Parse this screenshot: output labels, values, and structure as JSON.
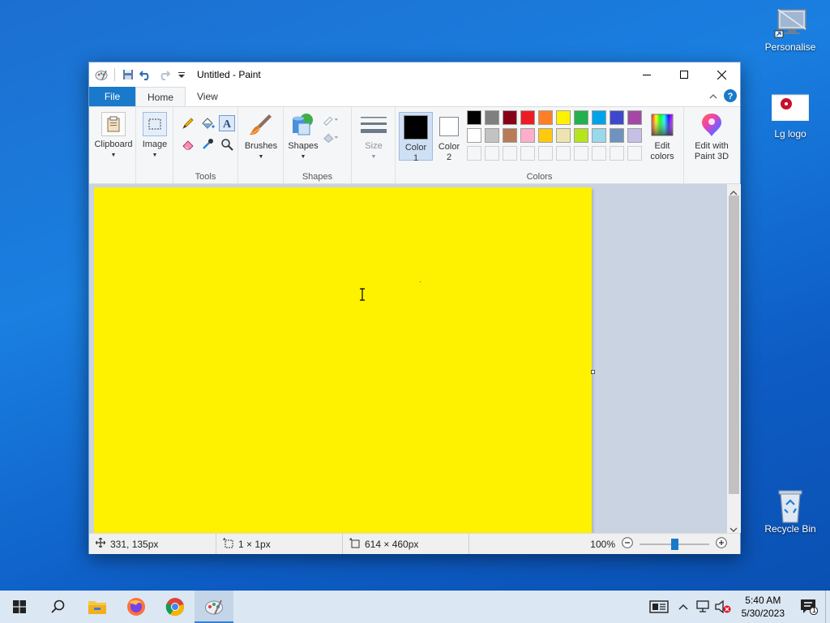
{
  "desktop": {
    "icons": [
      {
        "label": "Personalise"
      },
      {
        "label": "Lg logo"
      },
      {
        "label": "Recycle Bin"
      }
    ]
  },
  "window": {
    "title": "Untitled - Paint",
    "tabs": {
      "file": "File",
      "home": "Home",
      "view": "View"
    },
    "ribbon": {
      "clipboard": "Clipboard",
      "image": "Image",
      "tools_group": "Tools",
      "brushes": "Brushes",
      "shapes": "Shapes",
      "shapes_group": "Shapes",
      "size": "Size",
      "color1_line1": "Color",
      "color1_line2": "1",
      "color2_line1": "Color",
      "color2_line2": "2",
      "colors_group": "Colors",
      "edit_colors_line1": "Edit",
      "edit_colors_line2": "colors",
      "edit_paint3d_line1": "Edit with",
      "edit_paint3d_line2": "Paint 3D"
    },
    "colors": {
      "color1": "#000000",
      "color2": "#ffffff",
      "canvas_fill": "#fff200",
      "palette_row1": [
        "#000000",
        "#7f7f7f",
        "#880015",
        "#ed1c24",
        "#ff7f27",
        "#fff200",
        "#22b14c",
        "#00a2e8",
        "#3f48cc",
        "#a349a4"
      ],
      "palette_row2": [
        "#ffffff",
        "#c3c3c3",
        "#b97a57",
        "#ffaec9",
        "#ffc90e",
        "#efe4b0",
        "#b5e61d",
        "#99d9ea",
        "#7092be",
        "#c8bfe7"
      ]
    },
    "status": {
      "cursor_pos": "331, 135px",
      "selection_size": "1 × 1px",
      "image_size": "614 × 460px",
      "zoom": "100%"
    }
  },
  "taskbar": {
    "time": "5:40 AM",
    "date": "5/30/2023",
    "notification_count": "1"
  }
}
